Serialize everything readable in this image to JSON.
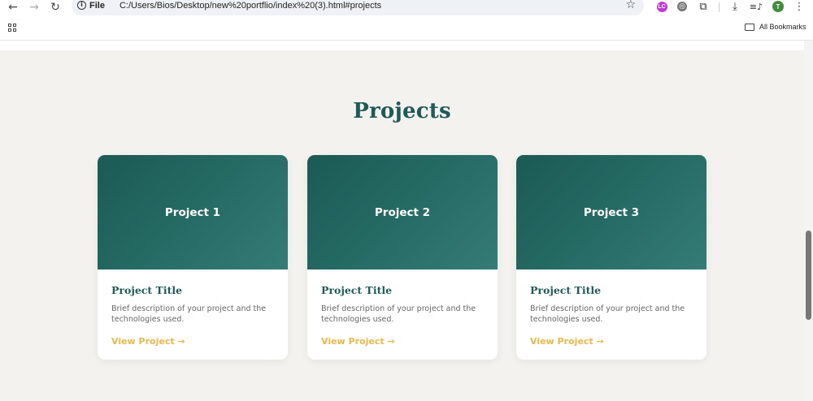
{
  "browser": {
    "back_icon": "arrow-left-icon",
    "forward_icon": "arrow-right-icon",
    "reload_icon": "reload-icon",
    "site_info_label": "File",
    "url": "C:/Users/Bios/Desktop/new%20portflio/index%20(3).html#projects",
    "avatar_initial": "T",
    "bookmarks_label": "All Bookmarks"
  },
  "page": {
    "section_title": "Projects",
    "cards": [
      {
        "image_label": "Project 1",
        "title": "Project Title",
        "description": "Brief description of your project and the technologies used.",
        "link": "View Project →"
      },
      {
        "image_label": "Project 2",
        "title": "Project Title",
        "description": "Brief description of your project and the technologies used.",
        "link": "View Project →"
      },
      {
        "image_label": "Project 3",
        "title": "Project Title",
        "description": "Brief description of your project and the technologies used.",
        "link": "View Project →"
      }
    ]
  },
  "colors": {
    "accent_teal": "#1e5b58",
    "link_gold": "#e8b84a",
    "page_background": "#f4f2ee"
  }
}
